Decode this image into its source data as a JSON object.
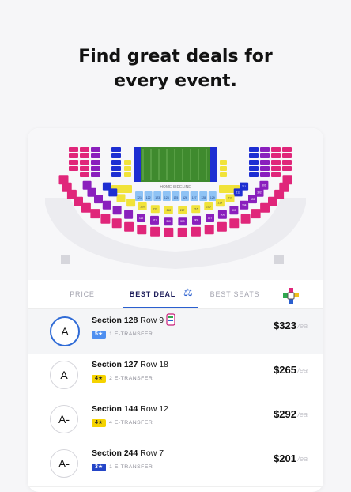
{
  "headline": {
    "line1": "Find great deals for",
    "line2": "every event."
  },
  "map": {
    "field_label": "HOME SIDELINE",
    "section_numbers_lower": [
      "121",
      "122",
      "123",
      "124",
      "125",
      "126",
      "127",
      "128",
      "129"
    ],
    "section_numbers_mid": [
      "211",
      "212",
      "213",
      "214",
      "215",
      "216",
      "217",
      "218",
      "219",
      "220"
    ],
    "section_numbers_upper": [
      "301",
      "302",
      "303",
      "304",
      "305",
      "306",
      "307",
      "308",
      "309",
      "310",
      "311",
      "312"
    ],
    "colors": {
      "pink": "#e0267a",
      "purple": "#8a1fbd",
      "blue": "#1d2ed2",
      "light_blue": "#8fc3f5",
      "yellow": "#f1e33a",
      "field": "#3f8a2e",
      "gray": "#d6d6dc"
    }
  },
  "tabs": {
    "price": "PRICE",
    "best_deal": "BEST DEAL",
    "best_seats": "BEST SEATS",
    "scale_icon": "scale-icon",
    "brand_icon": "brand-logo-icon"
  },
  "listings": [
    {
      "grade": "A",
      "section": "Section 128",
      "row": "Row 9",
      "badge": "5★",
      "badge_color": "lblue",
      "transfer": "1 E-TRANSFER",
      "price": "$323",
      "per": "/ea",
      "selected": true,
      "deal_tag": true
    },
    {
      "grade": "A",
      "section": "Section 127",
      "row": "Row 18",
      "badge": "4★",
      "badge_color": "yellow",
      "transfer": "2 E-TRANSFER",
      "price": "$265",
      "per": "/ea",
      "selected": false,
      "deal_tag": false
    },
    {
      "grade": "A-",
      "section": "Section 144",
      "row": "Row 12",
      "badge": "4★",
      "badge_color": "yellow",
      "transfer": "4 E-TRANSFER",
      "price": "$292",
      "per": "/ea",
      "selected": false,
      "deal_tag": false
    },
    {
      "grade": "A-",
      "section": "Section 244",
      "row": "Row 7",
      "badge": "3★",
      "badge_color": "blue",
      "transfer": "1 E-TRANSFER",
      "price": "$201",
      "per": "/ea",
      "selected": false,
      "deal_tag": false
    }
  ]
}
